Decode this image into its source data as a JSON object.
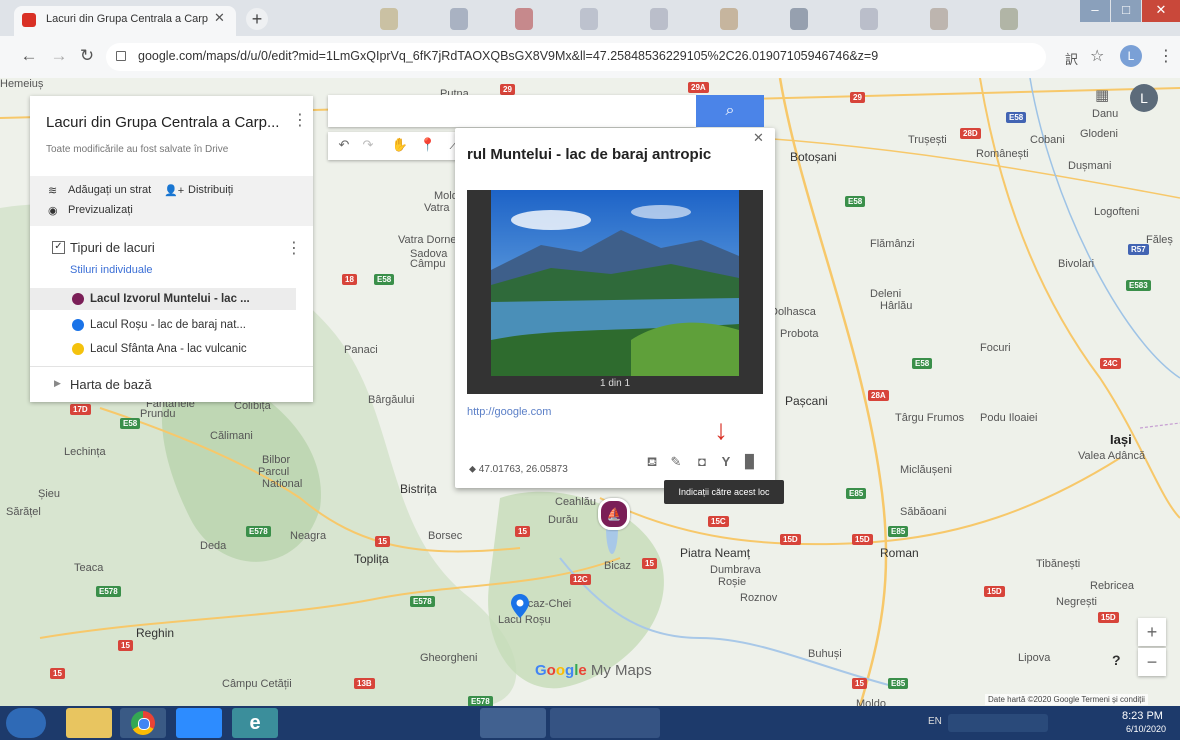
{
  "browser": {
    "tab_title": "Lacuri din Grupa Centrala a Carp",
    "url": "google.com/maps/d/u/0/edit?mid=1LmGxQIprVq_6fK7jRdTAOXQBsGX8V9Mx&ll=47.25848536229105%2C26.01907105946746&z=9",
    "profile_initial": "L"
  },
  "panel": {
    "title": "Lacuri din Grupa Centrala a Carp...",
    "status": "Toate modificările au fost salvate în Drive",
    "add_layer": "Adăugați un strat",
    "share": "Distribuiți",
    "preview": "Previzualizați",
    "layer_title": "Tipuri de lacuri",
    "layer_styles": "Stiluri individuale",
    "places": [
      {
        "label": "Lacul Izvorul Muntelui - lac ...",
        "color": "#7a1e57"
      },
      {
        "label": "Lacul Roșu - lac de baraj nat...",
        "color": "#1a73e8"
      },
      {
        "label": "Lacul Sfânta Ana - lac vulcanic",
        "color": "#f4c20d"
      }
    ],
    "basemap": "Harta de bază"
  },
  "popup": {
    "title": "rul Muntelui - lac de baraj antropic",
    "photo_count": "1 din 1",
    "link": "http://google.com",
    "coords": "47.01763, 26.05873",
    "tooltip": "Indicații către acest loc"
  },
  "map": {
    "brand": "Google My Maps",
    "attribution": "Date hartă ©2020 Google   Termeni și condiții",
    "account_initial": "L",
    "labels": [
      {
        "t": "Putna",
        "c": "maplabel"
      },
      {
        "t": "Botoșani",
        "c": "maplabel city"
      },
      {
        "t": "Trușești",
        "c": "maplabel"
      },
      {
        "t": "Românești",
        "c": "maplabel"
      },
      {
        "t": "Cobani",
        "c": "maplabel"
      },
      {
        "t": "Glodeni",
        "c": "maplabel"
      },
      {
        "t": "Dușmani",
        "c": "maplabel"
      },
      {
        "t": "Danu",
        "c": "maplabel"
      },
      {
        "t": "Logofteni",
        "c": "maplabel"
      },
      {
        "t": "Flămânzi",
        "c": "maplabel"
      },
      {
        "t": "Bivolari",
        "c": "maplabel"
      },
      {
        "t": "Făleș",
        "c": "maplabel"
      },
      {
        "t": "Deleni",
        "c": "maplabel"
      },
      {
        "t": "Hârlău",
        "c": "maplabel"
      },
      {
        "t": "Dolhasca",
        "c": "maplabel"
      },
      {
        "t": "Probota",
        "c": "maplabel"
      },
      {
        "t": "Focuri",
        "c": "maplabel"
      },
      {
        "t": "Pașcani",
        "c": "maplabel city"
      },
      {
        "t": "Târgu Frumos",
        "c": "maplabel"
      },
      {
        "t": "Podu Iloaiei",
        "c": "maplabel"
      },
      {
        "t": "Iași",
        "c": "maplabel big"
      },
      {
        "t": "Valea Adâncă",
        "c": "maplabel"
      },
      {
        "t": "Miclăușeni",
        "c": "maplabel"
      },
      {
        "t": "Săbăoani",
        "c": "maplabel"
      },
      {
        "t": "Roman",
        "c": "maplabel city"
      },
      {
        "t": "Tibănești",
        "c": "maplabel"
      },
      {
        "t": "Rebricea",
        "c": "maplabel"
      },
      {
        "t": "Negrești",
        "c": "maplabel"
      },
      {
        "t": "Piatra Neamț",
        "c": "maplabel city"
      },
      {
        "t": "Dumbrava",
        "c": "maplabel"
      },
      {
        "t": "Roșie",
        "c": "maplabel"
      },
      {
        "t": "Roznov",
        "c": "maplabel"
      },
      {
        "t": "Bicaz",
        "c": "maplabel"
      },
      {
        "t": "Ceahlău",
        "c": "maplabel"
      },
      {
        "t": "Durău",
        "c": "maplabel"
      },
      {
        "t": "Bicaz-Chei",
        "c": "maplabel"
      },
      {
        "t": "Lacu Roșu",
        "c": "maplabel"
      },
      {
        "t": "Buhuși",
        "c": "maplabel"
      },
      {
        "t": "Lipova",
        "c": "maplabel"
      },
      {
        "t": "Gheorgheni",
        "c": "maplabel"
      },
      {
        "t": "Reghin",
        "c": "maplabel city"
      },
      {
        "t": "Câmpu Cetății",
        "c": "maplabel"
      },
      {
        "t": "Toplița",
        "c": "maplabel city"
      },
      {
        "t": "Borsec",
        "c": "maplabel"
      },
      {
        "t": "Neagra",
        "c": "maplabel"
      },
      {
        "t": "Deda",
        "c": "maplabel"
      },
      {
        "t": "Teaca",
        "c": "maplabel"
      },
      {
        "t": "Șieu",
        "c": "maplabel"
      },
      {
        "t": "Sărățel",
        "c": "maplabel"
      },
      {
        "t": "Lechința",
        "c": "maplabel"
      },
      {
        "t": "Bistrița",
        "c": "maplabel city"
      },
      {
        "t": "Bilbor",
        "c": "maplabel"
      },
      {
        "t": "Parcul",
        "c": "maplabel"
      },
      {
        "t": "National",
        "c": "maplabel"
      },
      {
        "t": "Călimani",
        "c": "maplabel"
      },
      {
        "t": "Colibița",
        "c": "maplabel"
      },
      {
        "t": "Fântânele",
        "c": "maplabel"
      },
      {
        "t": "Prundu",
        "c": "maplabel"
      },
      {
        "t": "Bârgăului",
        "c": "maplabel"
      },
      {
        "t": "Panaci",
        "c": "maplabel"
      },
      {
        "t": "Vatra Dornei",
        "c": "maplabel"
      },
      {
        "t": "Sadova",
        "c": "maplabel"
      },
      {
        "t": "Câmpu",
        "c": "maplabel"
      },
      {
        "t": "Moldovei",
        "c": "maplabel"
      },
      {
        "t": "Vatra",
        "c": "maplabel"
      },
      {
        "t": "Moldo",
        "c": "maplabel"
      },
      {
        "t": "Hemeiuș",
        "c": "maplabel"
      }
    ]
  },
  "taskbar": {
    "time": "8:23 PM",
    "date": "6/10/2020",
    "lang": "EN"
  },
  "colors": {
    "accent": "#4b84e8",
    "marker_izvorul": "#7a1e57",
    "marker_rosu": "#1a73e8",
    "marker_sfanta": "#f4c20d",
    "arrow": "#d93025"
  }
}
